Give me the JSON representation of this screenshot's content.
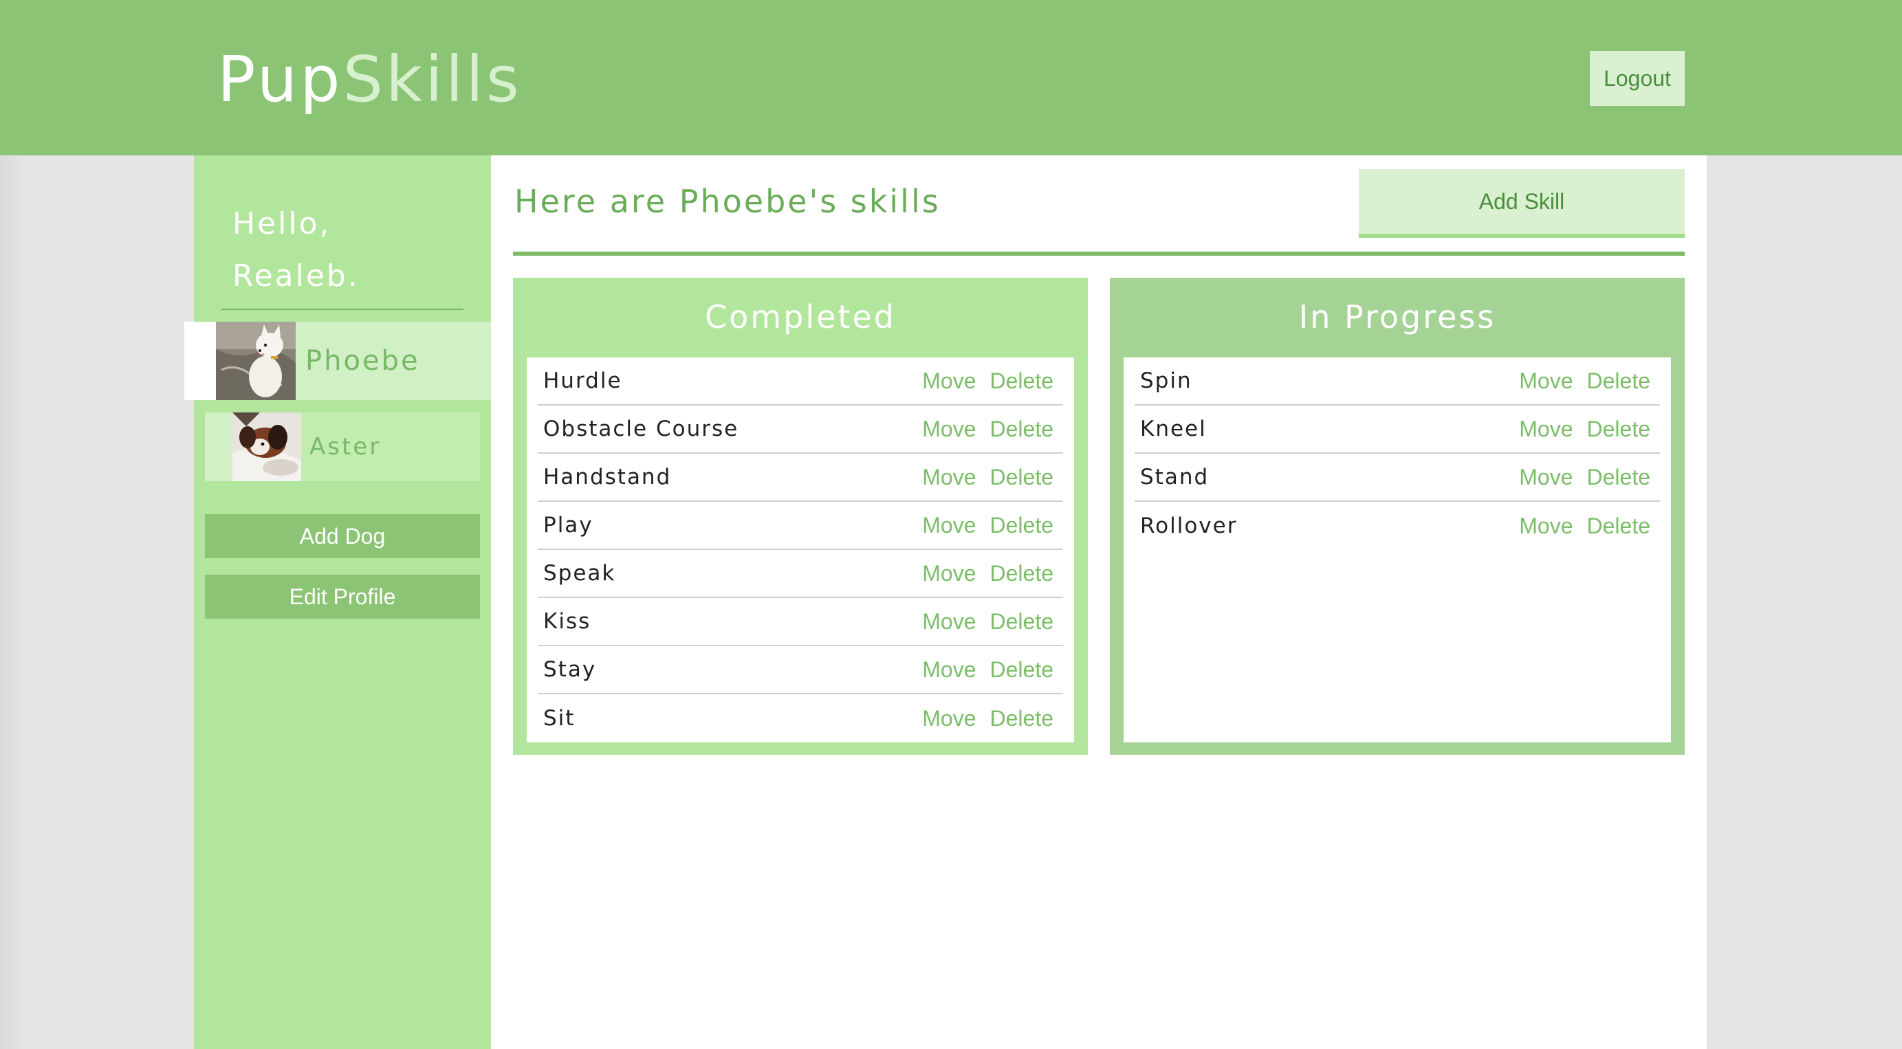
{
  "app": {
    "logo_part1": "Pup",
    "logo_part2": "Skills",
    "logout_label": "Logout"
  },
  "sidebar": {
    "greeting_line1": "Hello,",
    "greeting_line2": "Realeb.",
    "dogs": [
      {
        "name": "Phoebe",
        "selected": true
      },
      {
        "name": "Aster",
        "selected": false
      }
    ],
    "add_dog_label": "Add Dog",
    "edit_profile_label": "Edit Profile"
  },
  "main": {
    "heading": "Here are Phoebe's skills",
    "add_skill_label": "Add Skill",
    "move_label": "Move",
    "delete_label": "Delete",
    "completed": {
      "title": "Completed",
      "skills": [
        "Hurdle",
        "Obstacle Course",
        "Handstand",
        "Play",
        "Speak",
        "Kiss",
        "Stay",
        "Sit"
      ]
    },
    "in_progress": {
      "title": "In Progress",
      "skills": [
        "Spin",
        "Kneel",
        "Stand",
        "Rollover"
      ]
    }
  },
  "colors": {
    "header_green": "#8bc474",
    "sidebar_green": "#b2e69c",
    "accent_text": "#6aac58",
    "link_green": "#7cbd68"
  }
}
